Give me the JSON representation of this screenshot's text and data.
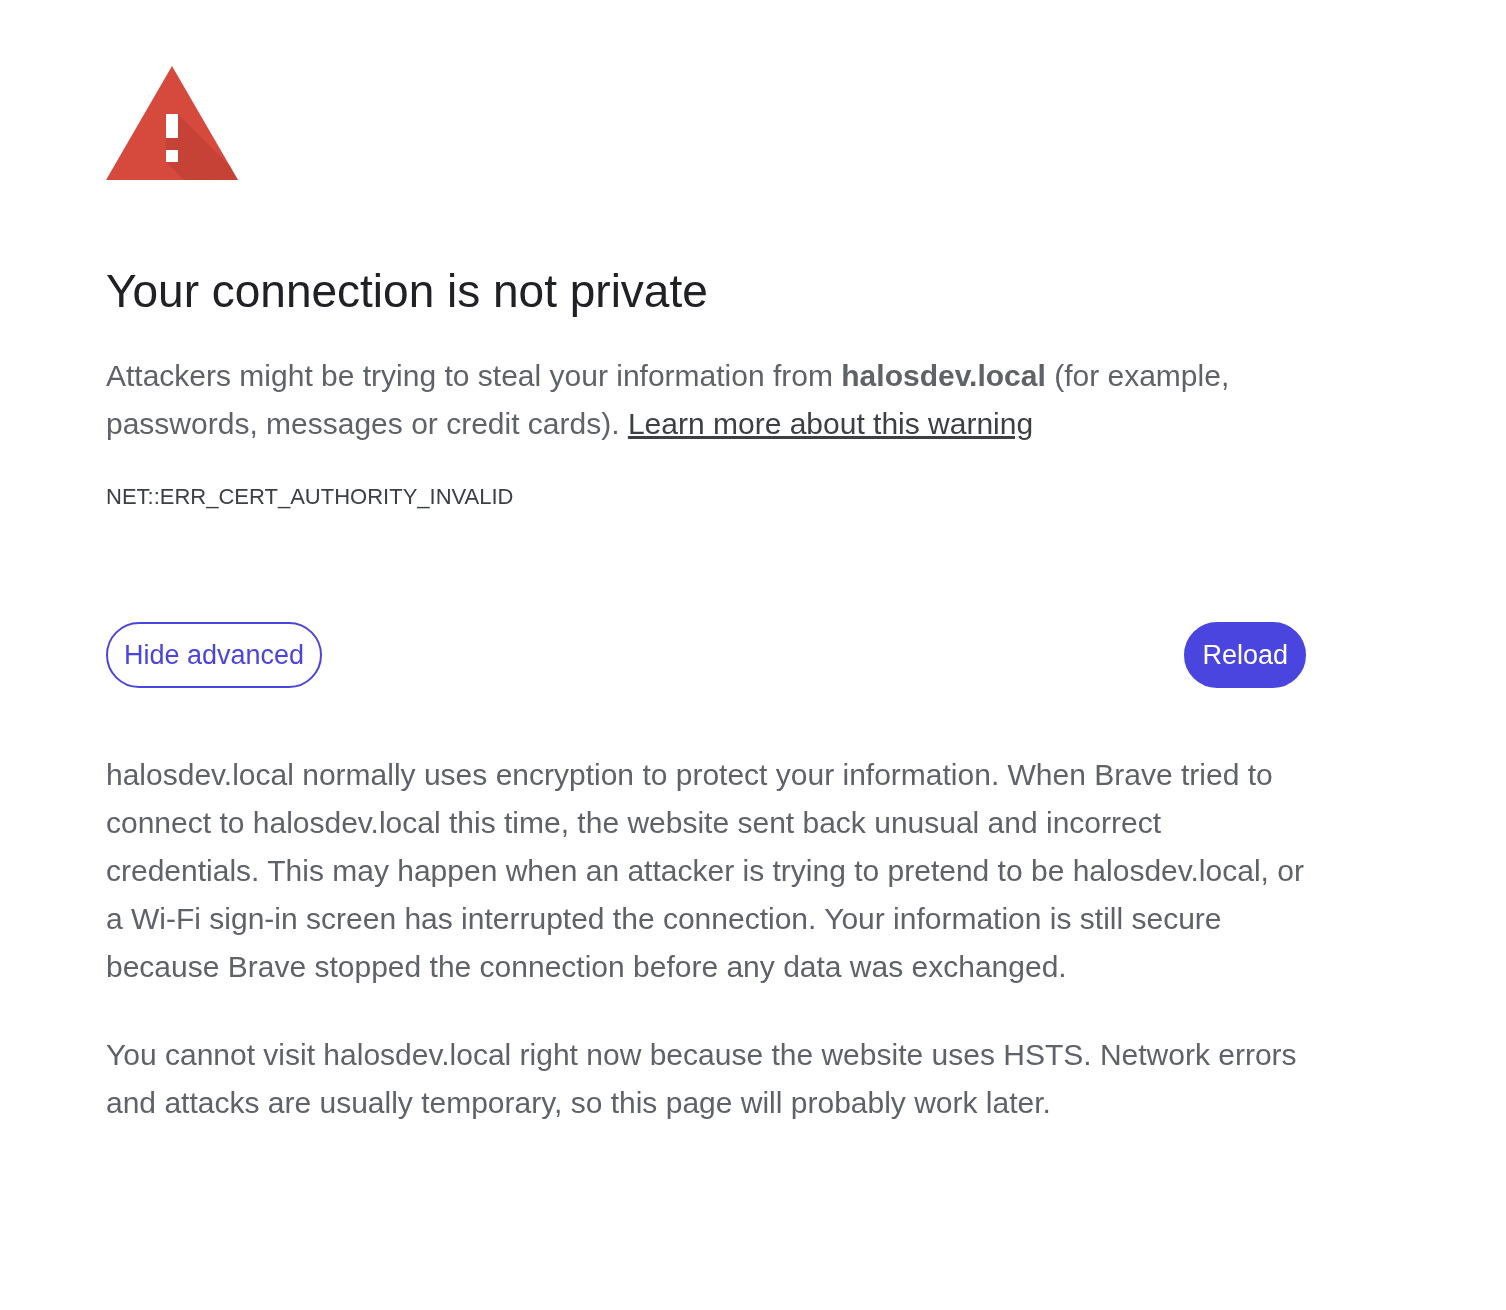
{
  "page": {
    "title": "Your connection is not private",
    "intro": {
      "text": "Attackers might be trying to steal your information from **halosdev.local** (for example, passwords, messages or credit cards).",
      "link": "Learn more about this warning"
    },
    "error_code": "NET::ERR_CERT_AUTHORITY_INVALID"
  },
  "buttons": [
    {
      "kind": "secondary",
      "label": "Hide advanced"
    },
    {
      "kind": "primary",
      "label": "Reload"
    }
  ],
  "details": [
    "halosdev.local normally uses encryption to protect your information. When Brave tried to connect to halosdev.local this time, the website sent back unusual and incorrect credentials. This may happen when an attacker is trying to pretend to be halosdev.local, or a Wi-Fi sign-in screen has interrupted the connection. Your information is still secure because Brave stopped the connection before any data was exchanged.",
    "You cannot visit halosdev.local right now because the website uses HSTS. Network errors and attacks are usually temporary, so this page will probably work later."
  ]
}
